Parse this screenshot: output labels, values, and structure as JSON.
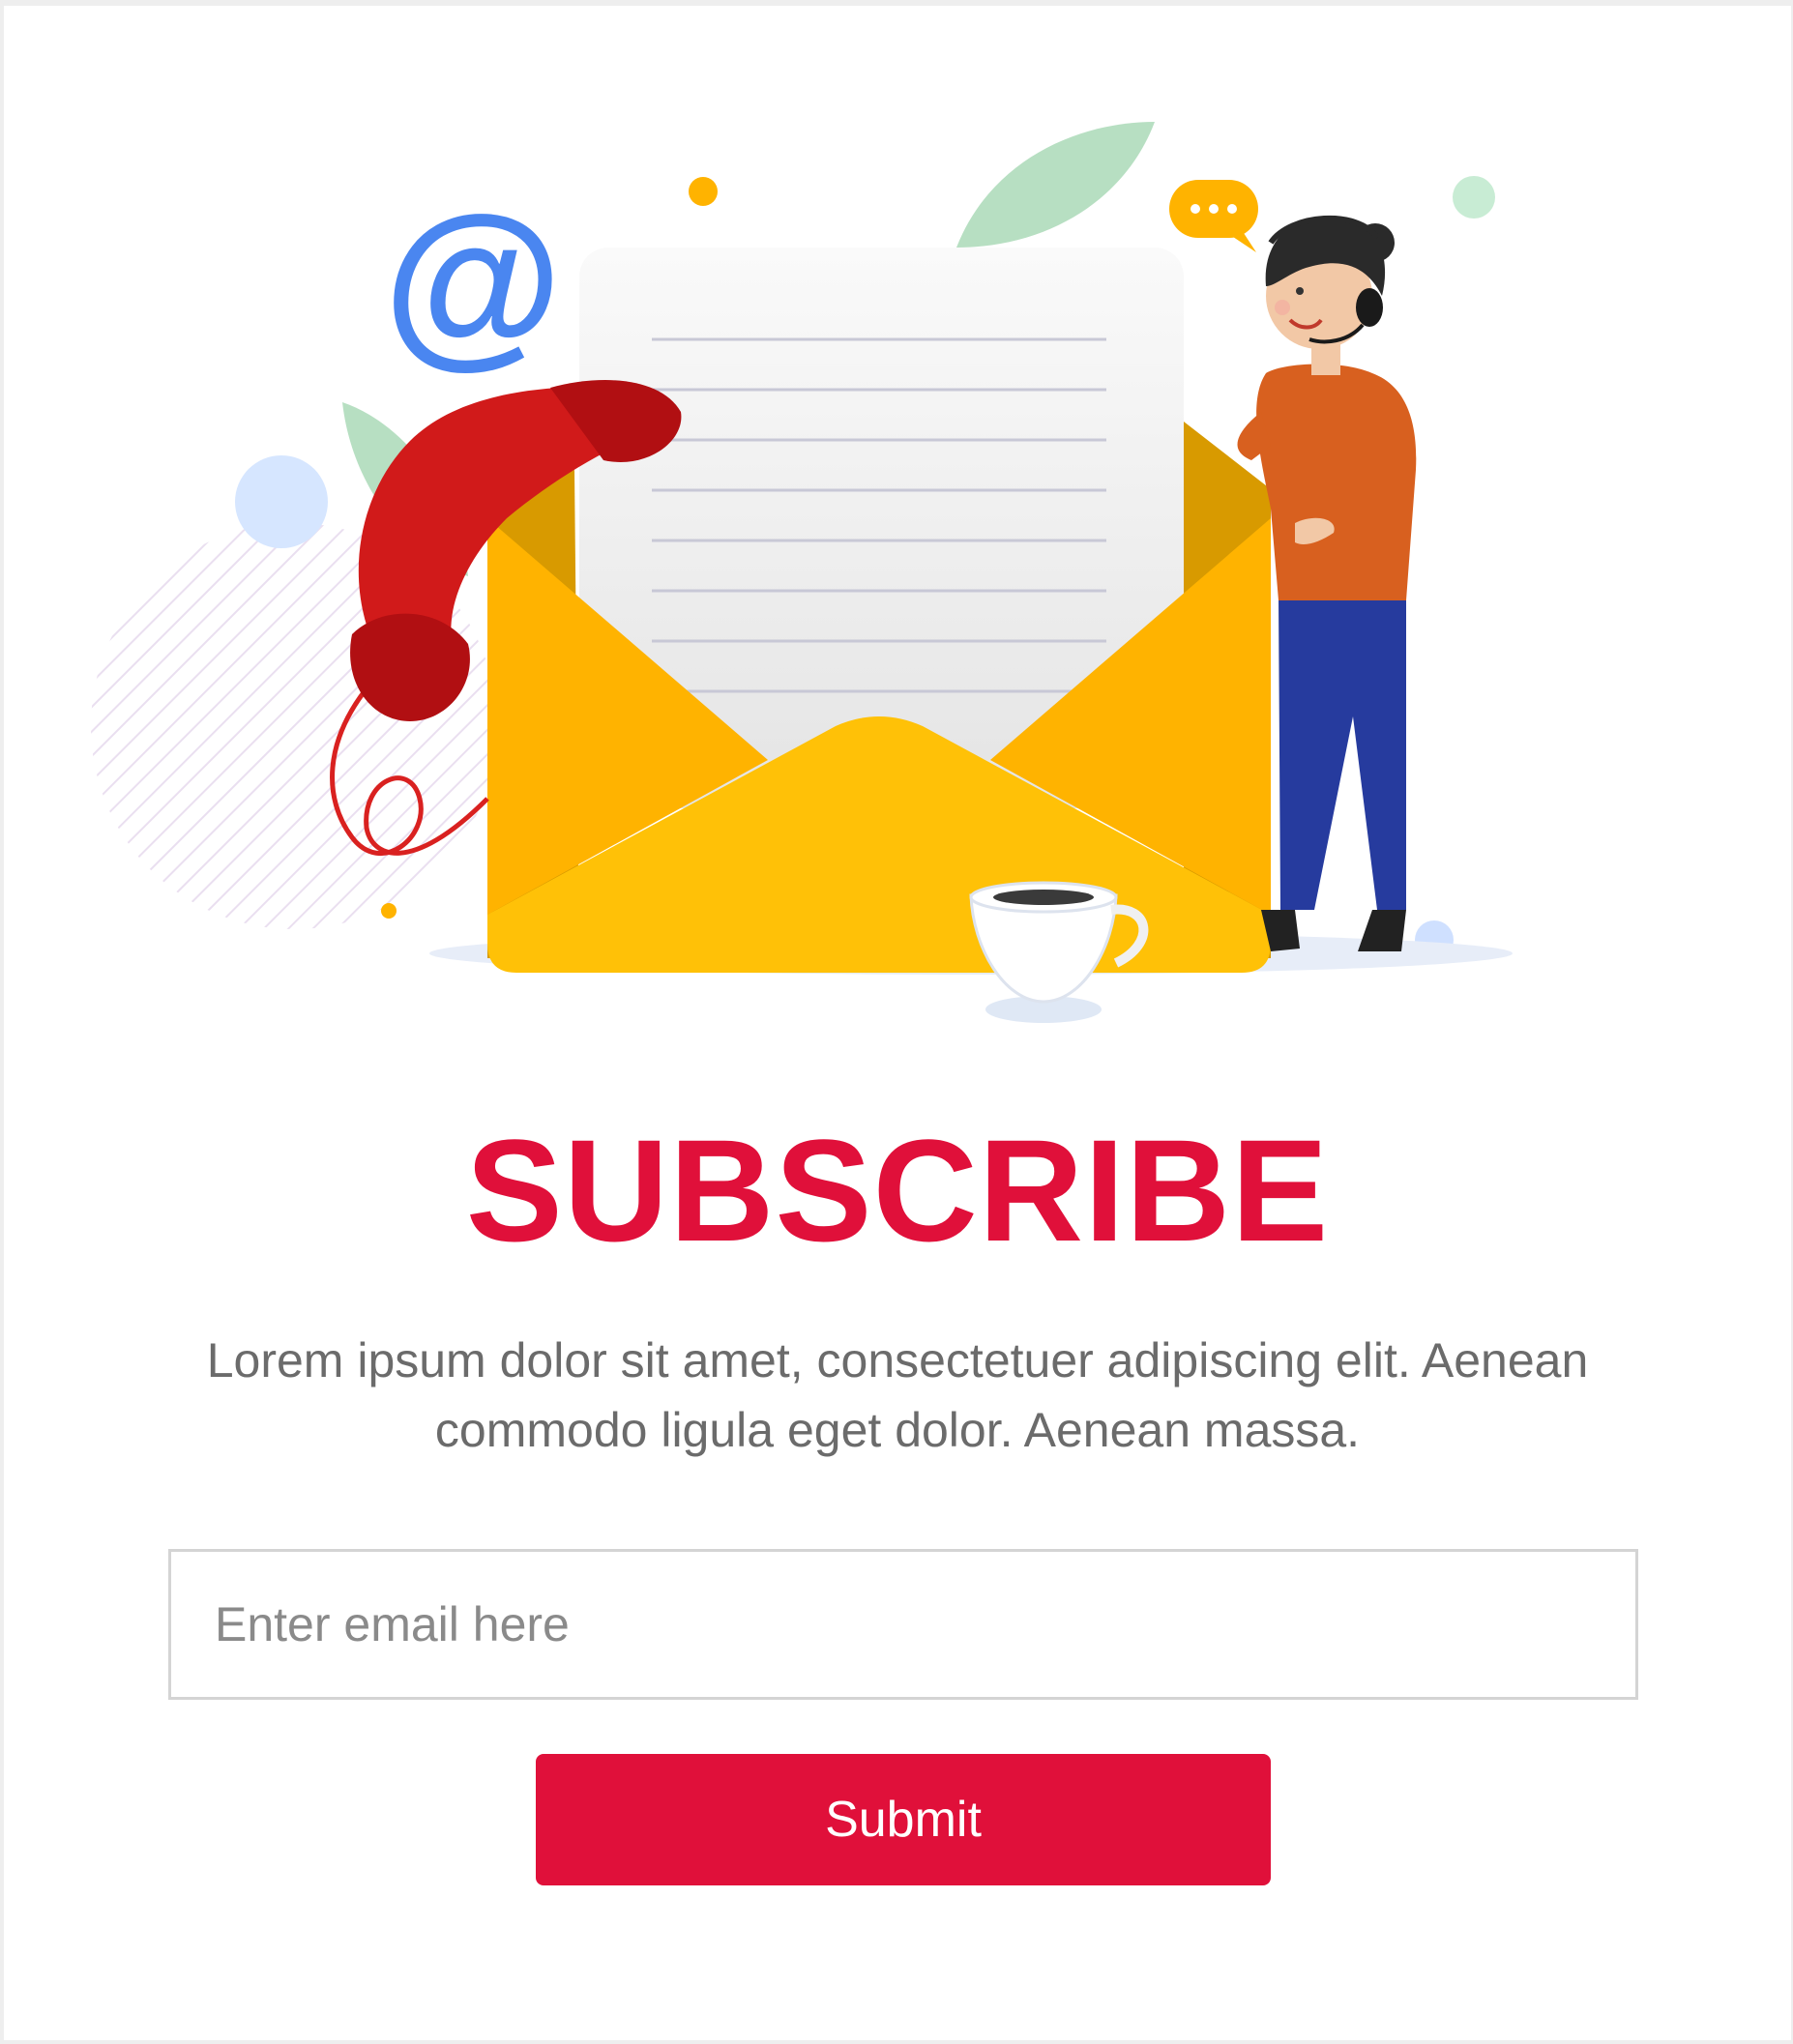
{
  "illustration": {
    "icons": [
      "at-sign-icon",
      "telephone-icon",
      "envelope-icon",
      "letter-icon",
      "chat-bubble-icon",
      "coffee-cup-icon",
      "support-agent-figure"
    ]
  },
  "subscribe": {
    "title": "SUBSCRIBE",
    "description": "Lorem ipsum dolor sit amet, consectetuer adipiscing elit. Aenean commodo ligula eget dolor. Aenean massa.",
    "email_placeholder": "Enter email here",
    "email_value": "",
    "submit_label": "Submit"
  },
  "colors": {
    "accent": "#e0103a",
    "envelope": "#ffb800",
    "text_muted": "#6b6b6b",
    "border": "#d4d4d4"
  }
}
